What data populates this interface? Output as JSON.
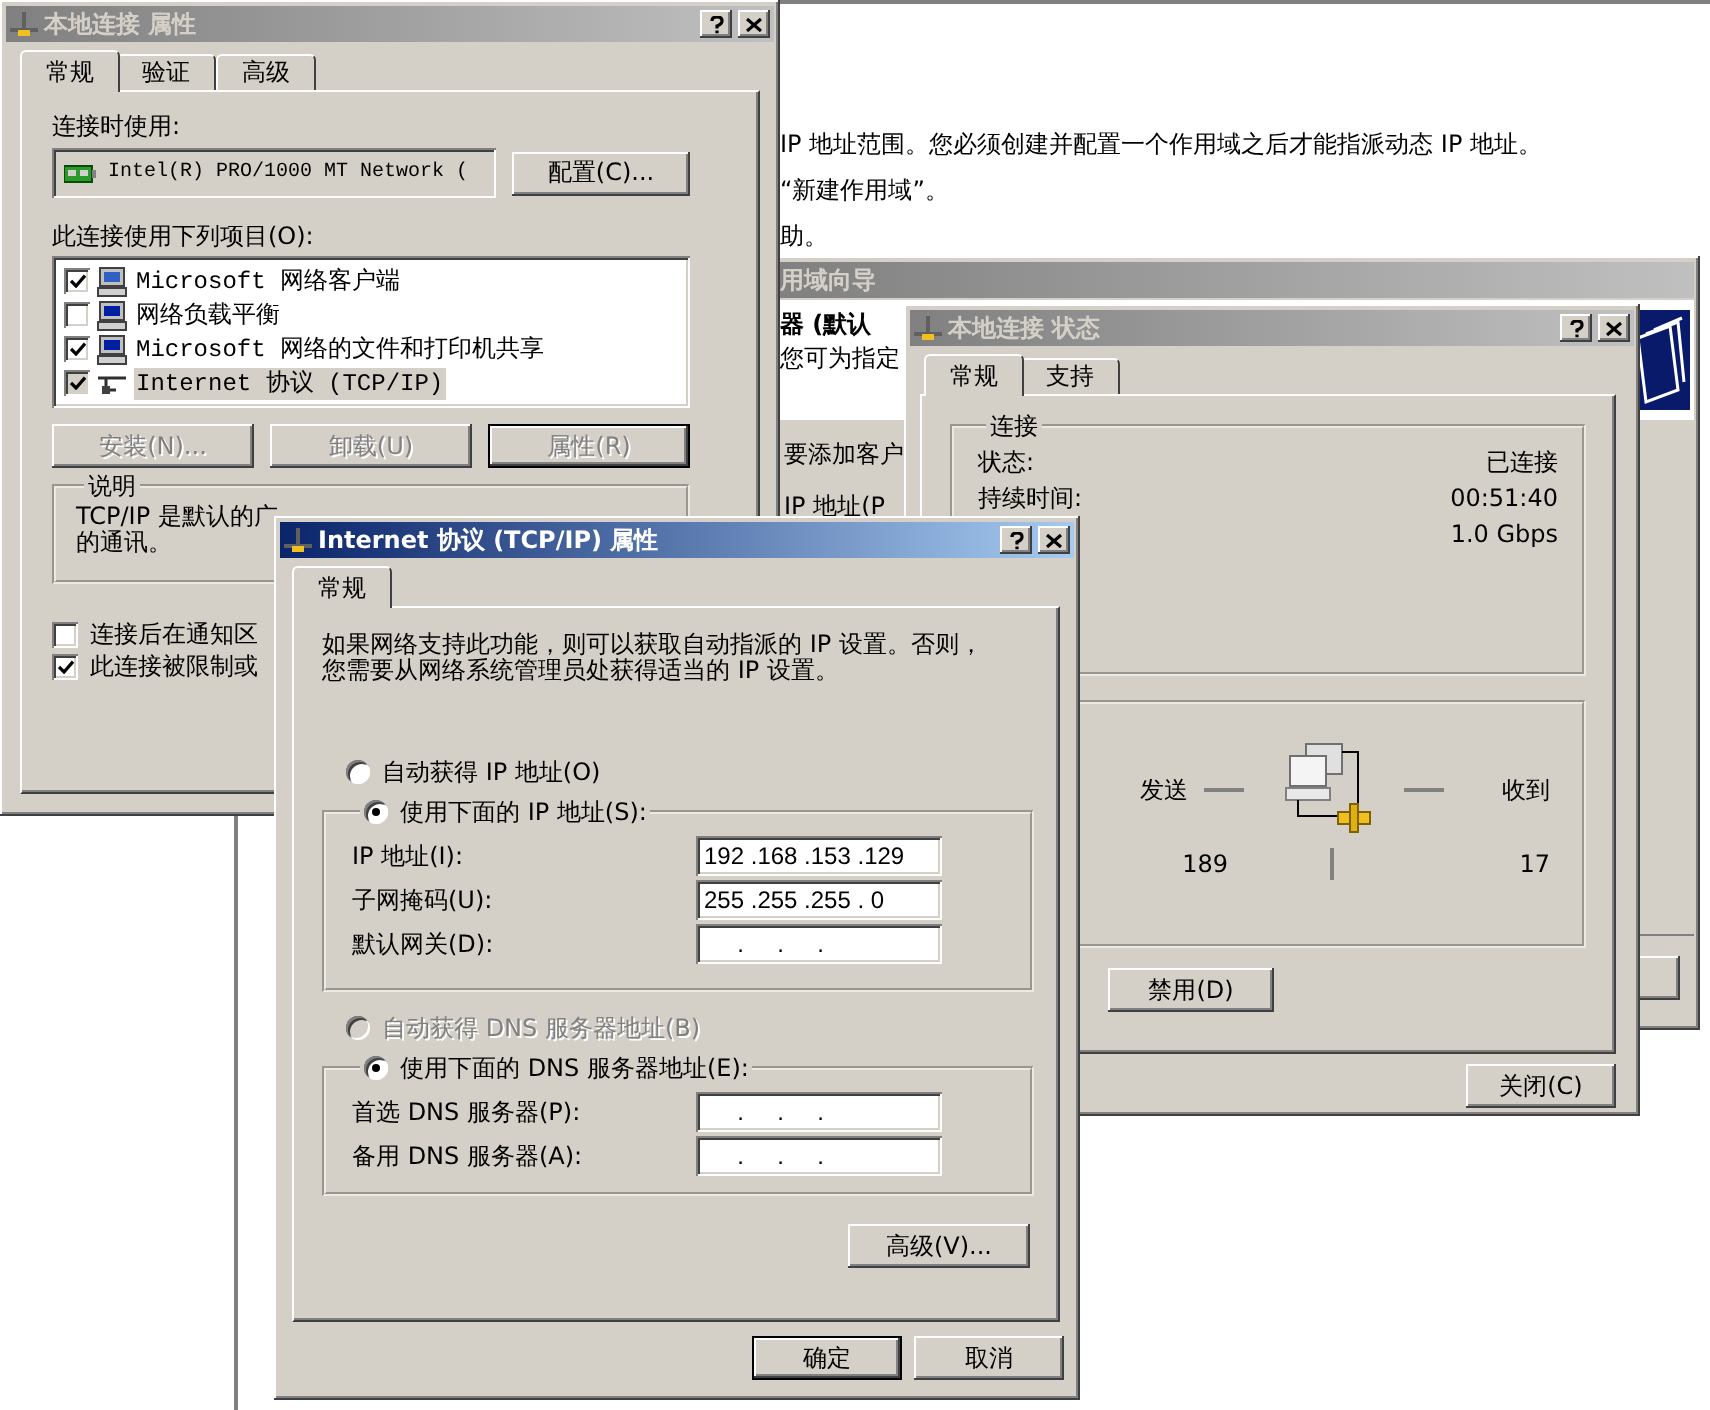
{
  "desktop_text": {
    "lines": [
      "IP 地址范围。您必须创建并配置一个作用域之后才能指派动态 IP 地址。",
      "“新建作用域”。",
      "助。"
    ]
  },
  "wizard_window": {
    "title": "用域向导",
    "active": false,
    "banner_heading": "器 (默认",
    "banner_text": "您可为指定",
    "body_lines": [
      "要添加客户",
      "IP 地址(P"
    ]
  },
  "properties_window": {
    "title": "本地连接 属性",
    "active": false,
    "tabs": [
      {
        "label": "常规",
        "selected": true
      },
      {
        "label": "验证",
        "selected": false
      },
      {
        "label": "高级",
        "selected": false
      }
    ],
    "connect_using_label": "连接时使用:",
    "adapter": "Intel(R) PRO/1000 MT Network (",
    "configure_button": "配置(C)...",
    "components_label": "此连接使用下列项目(O):",
    "components": [
      {
        "label": "Microsoft 网络客户端",
        "checked": true,
        "selected": false,
        "kind": "client"
      },
      {
        "label": "网络负载平衡",
        "checked": false,
        "selected": false,
        "kind": "service"
      },
      {
        "label": "Microsoft 网络的文件和打印机共享",
        "checked": true,
        "selected": false,
        "kind": "service"
      },
      {
        "label": "Internet 协议 (TCP/IP)",
        "checked": true,
        "selected": true,
        "kind": "protocol"
      }
    ],
    "buttons": [
      {
        "label": "安装(N)...",
        "disabled": true
      },
      {
        "label": "卸载(U)",
        "disabled": true
      },
      {
        "label": "属性(R)",
        "disabled": true
      }
    ],
    "description": {
      "title": "说明",
      "lines": [
        "TCP/IP 是默认的广",
        "的通讯。"
      ]
    },
    "options": [
      {
        "label": "连接后在通知区",
        "checked": false
      },
      {
        "label": "此连接被限制或",
        "checked": true
      }
    ]
  },
  "status_window": {
    "title": "本地连接 状态",
    "active": false,
    "tabs": [
      {
        "label": "常规",
        "selected": true
      },
      {
        "label": "支持",
        "selected": false
      }
    ],
    "connection": {
      "title": "连接",
      "rows": [
        {
          "label": "状态:",
          "value": "已连接"
        },
        {
          "label": "持续时间:",
          "value": "00:51:40"
        },
        {
          "value": "1.0 Gbps"
        }
      ]
    },
    "activity": {
      "sent_label": "发送",
      "received_label": "收到",
      "sent": "189",
      "received": "17"
    },
    "disable_button": "禁用(D)",
    "close_button": "关闭(C)"
  },
  "tcpip_window": {
    "title": "Internet 协议 (TCP/IP) 属性",
    "active": true,
    "tabs": [
      {
        "label": "常规",
        "selected": true
      }
    ],
    "intro_lines": [
      "如果网络支持此功能，则可以获取自动指派的 IP 设置。否则，",
      "您需要从网络系统管理员处获得适当的 IP 设置。"
    ],
    "ip_options": [
      {
        "label": "自动获得 IP 地址(O)",
        "selected": false,
        "disabled": false
      },
      {
        "label": "使用下面的 IP 地址(S):",
        "selected": true,
        "disabled": false
      }
    ],
    "ip_fields": [
      {
        "label": "IP 地址(I):",
        "value": "192 .168 .153 .129"
      },
      {
        "label": "子网掩码(U):",
        "value": "255 .255 .255 . 0"
      },
      {
        "label": "默认网关(D):",
        "value": "     .     .     ."
      }
    ],
    "dns_options": [
      {
        "label": "自动获得 DNS 服务器地址(B)",
        "selected": false,
        "disabled": true
      },
      {
        "label": "使用下面的 DNS 服务器地址(E):",
        "selected": true,
        "disabled": false
      }
    ],
    "dns_fields": [
      {
        "label": "首选 DNS 服务器(P):",
        "value": "     .     .     ."
      },
      {
        "label": "备用 DNS 服务器(A):",
        "value": "     .     .     ."
      }
    ],
    "advanced_button": "高级(V)...",
    "ok_button": "确定",
    "cancel_button": "取消"
  }
}
